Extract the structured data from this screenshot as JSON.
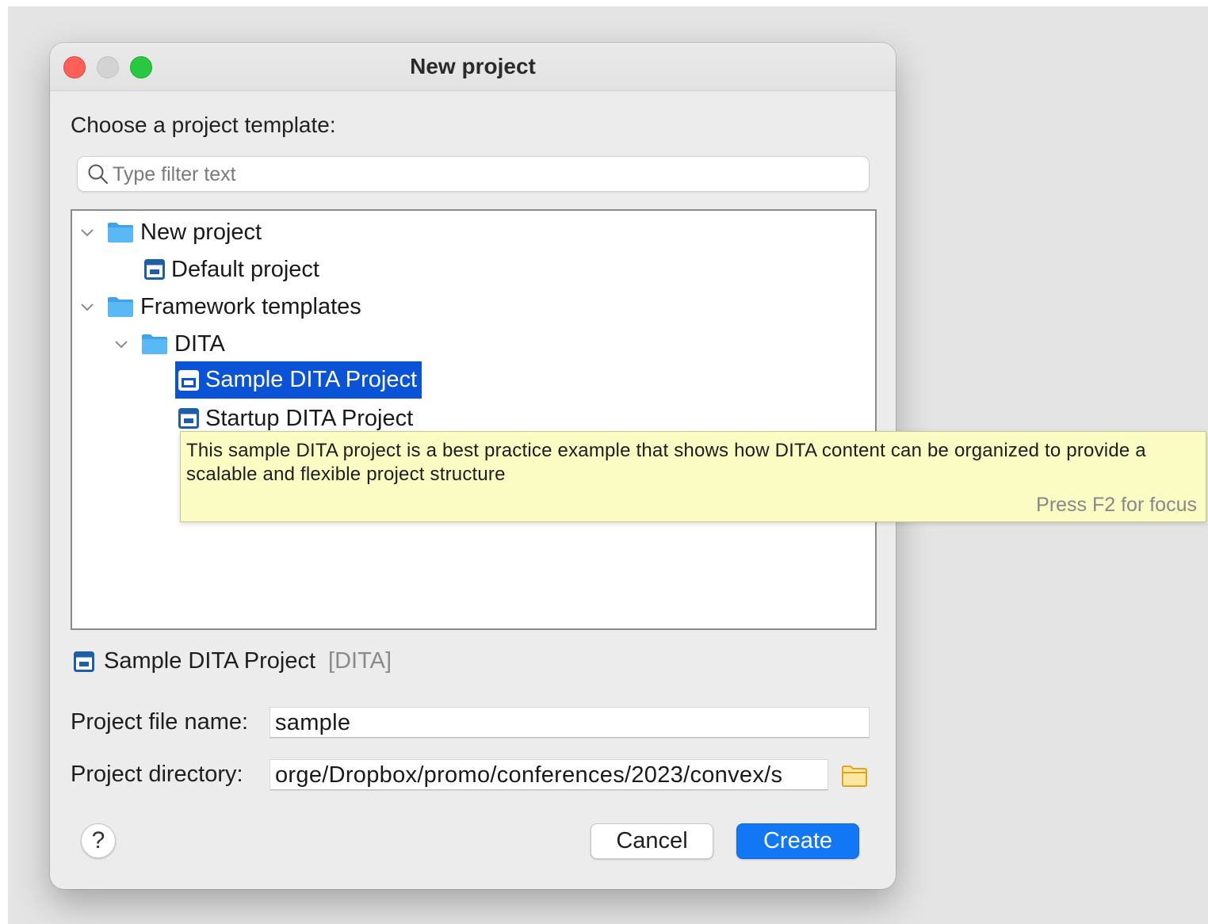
{
  "window": {
    "title": "New project"
  },
  "chooser": {
    "prompt": "Choose a project template:",
    "filter_placeholder": "Type filter text",
    "filter_value": ""
  },
  "tree": {
    "items": [
      {
        "label": "New project",
        "kind": "folder",
        "expanded": true,
        "depth": 0
      },
      {
        "label": "Default project",
        "kind": "project",
        "depth": 1
      },
      {
        "label": "Framework templates",
        "kind": "folder",
        "expanded": true,
        "depth": 0
      },
      {
        "label": "DITA",
        "kind": "folder",
        "expanded": true,
        "depth": 1
      },
      {
        "label": "Sample DITA Project",
        "kind": "project",
        "depth": 2,
        "selected": true
      },
      {
        "label": "Startup DITA Project",
        "kind": "project",
        "depth": 2
      }
    ]
  },
  "tooltip": {
    "description_line1": "This sample DITA project is a best practice example that shows how DITA content can be organized to provide a",
    "description_line2": "scalable and flexible project structure",
    "hint": "Press F2 for focus"
  },
  "selection": {
    "name": "Sample DITA Project",
    "category": "[DITA]"
  },
  "form": {
    "file_name_label": "Project file name:",
    "file_name_value": "sample",
    "directory_label": "Project directory:",
    "directory_value": "orge/Dropbox/promo/conferences/2023/convex/s"
  },
  "buttons": {
    "help": "?",
    "cancel": "Cancel",
    "create": "Create"
  },
  "colors": {
    "selection": "#0a52d6",
    "primary_button": "#1277f5",
    "tooltip_bg": "#fbfbc4",
    "folder": "#5ab8f5"
  }
}
